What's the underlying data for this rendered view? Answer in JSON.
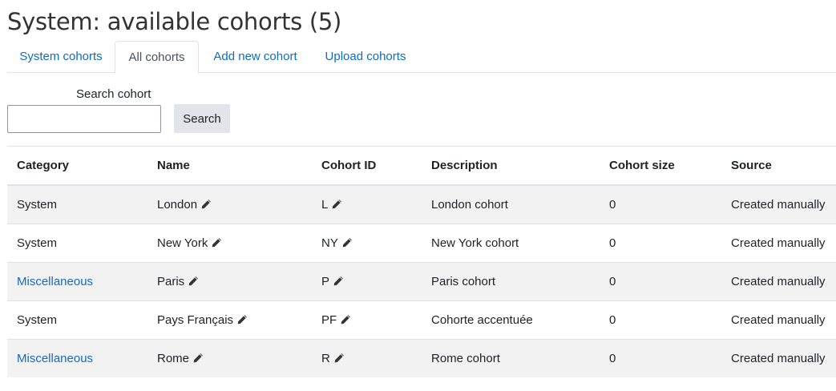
{
  "title": "System: available cohorts (5)",
  "tabs": [
    {
      "label": "System cohorts",
      "active": false
    },
    {
      "label": "All cohorts",
      "active": true
    },
    {
      "label": "Add new cohort",
      "active": false
    },
    {
      "label": "Upload cohorts",
      "active": false
    }
  ],
  "search": {
    "label": "Search cohort",
    "value": "",
    "button": "Search"
  },
  "table": {
    "headers": [
      "Category",
      "Name",
      "Cohort ID",
      "Description",
      "Cohort size",
      "Source"
    ],
    "rows": [
      {
        "category": "System",
        "category_link": false,
        "name": "London",
        "cohort_id": "L",
        "description": "London cohort",
        "size": "0",
        "source": "Created manually"
      },
      {
        "category": "System",
        "category_link": false,
        "name": "New York",
        "cohort_id": "NY",
        "description": "New York cohort",
        "size": "0",
        "source": "Created manually"
      },
      {
        "category": "Miscellaneous",
        "category_link": true,
        "name": "Paris",
        "cohort_id": "P",
        "description": "Paris cohort",
        "size": "0",
        "source": "Created manually"
      },
      {
        "category": "System",
        "category_link": false,
        "name": "Pays Français",
        "cohort_id": "PF",
        "description": "Cohorte accentuée",
        "size": "0",
        "source": "Created manually"
      },
      {
        "category": "Miscellaneous",
        "category_link": true,
        "name": "Rome",
        "cohort_id": "R",
        "description": "Rome cohort",
        "size": "0",
        "source": "Created manually"
      }
    ]
  },
  "colors": {
    "link": "#0f6cbf",
    "stripe": "#f2f2f2",
    "border": "#dee2e6"
  },
  "icons": {
    "edit": "pencil-icon"
  }
}
